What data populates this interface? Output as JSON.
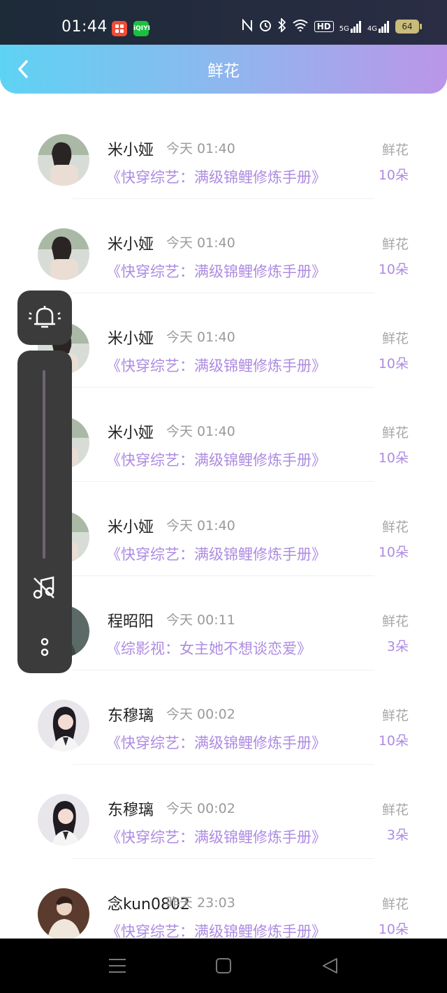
{
  "status": {
    "time": "01:44",
    "app_icons": [
      {
        "name": "xiaohongshu-app-icon",
        "label": "",
        "color": "#f24b36"
      },
      {
        "name": "iqiyi-app-icon",
        "label": "iQIYI",
        "color": "#19c23d"
      }
    ],
    "network": "5G",
    "network2": "4G",
    "hd": "HD",
    "battery": "64"
  },
  "header": {
    "title": "鲜花",
    "back_icon": "chevron-left-icon"
  },
  "items": [
    {
      "name": "米小娅",
      "time": "今天 01:40",
      "book": "《快穿综艺：满级锦鲤修炼手册》",
      "type": "鲜花",
      "count": "10朵",
      "avatar": "woman"
    },
    {
      "name": "米小娅",
      "time": "今天 01:40",
      "book": "《快穿综艺：满级锦鲤修炼手册》",
      "type": "鲜花",
      "count": "10朵",
      "avatar": "woman"
    },
    {
      "name": "米小娅",
      "time": "今天 01:40",
      "book": "《快穿综艺：满级锦鲤修炼手册》",
      "type": "鲜花",
      "count": "10朵",
      "avatar": "woman"
    },
    {
      "name": "米小娅",
      "time": "今天 01:40",
      "book": "《快穿综艺：满级锦鲤修炼手册》",
      "type": "鲜花",
      "count": "10朵",
      "avatar": "woman"
    },
    {
      "name": "米小娅",
      "time": "今天 01:40",
      "book": "《快穿综艺：满级锦鲤修炼手册》",
      "type": "鲜花",
      "count": "10朵",
      "avatar": "woman"
    },
    {
      "name": "程昭阳",
      "time": "今天 00:11",
      "book": "《综影视：女主她不想谈恋爱》",
      "type": "鲜花",
      "count": "3朵",
      "avatar": "dark"
    },
    {
      "name": "东穆璃",
      "time": "今天 00:02",
      "book": "《快穿综艺：满级锦鲤修炼手册》",
      "type": "鲜花",
      "count": "10朵",
      "avatar": "portrait"
    },
    {
      "name": "东穆璃",
      "time": "今天 00:02",
      "book": "《快穿综艺：满级锦鲤修炼手册》",
      "type": "鲜花",
      "count": "3朵",
      "avatar": "portrait"
    },
    {
      "name": "念kun0802",
      "time": "昨天 23:03",
      "book": "《快穿综艺：满级锦鲤修炼手册》",
      "type": "鲜花",
      "count": "10朵",
      "avatar": "man"
    }
  ],
  "floating": {
    "bell_icon": "bell-ring-icon",
    "music_icon": "music-off-icon",
    "more_icon": "more-icon"
  },
  "nav": {
    "menu_icon": "menu-icon",
    "home_icon": "home-icon",
    "back_icon": "back-triangle-icon"
  }
}
